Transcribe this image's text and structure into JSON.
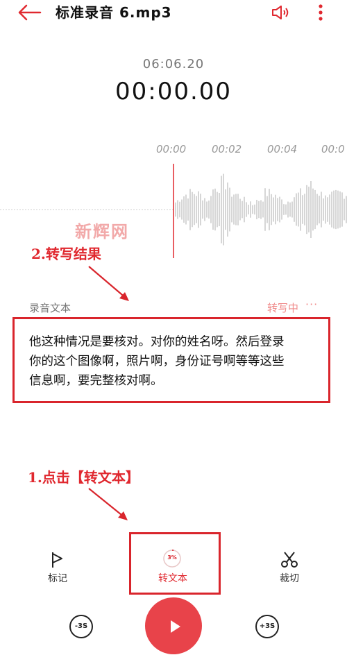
{
  "header": {
    "back_icon": "back-arrow-icon",
    "title": "标准录音 6.mp3",
    "speaker_icon": "speaker-icon",
    "more_icon": "more-vertical-icon"
  },
  "time": {
    "duration": "06:06.20",
    "current": "00:00.00"
  },
  "timeline": {
    "ticks": [
      "00:00",
      "00:02",
      "00:04",
      "00:0"
    ]
  },
  "watermark": "新辉网",
  "annotations": {
    "step2": "2.转写结果",
    "step1": "1.点击【转文本】"
  },
  "transcript": {
    "label": "录音文本",
    "status": "转写中",
    "status_dots": "···",
    "lines": [
      "他这种情况是要核对。对你的姓名呀。然后登录",
      "你的这个图像啊，照片啊，身份证号啊等等这些",
      "信息啊，要完整核对啊。"
    ]
  },
  "tools": {
    "mark_label": "标记",
    "convert_label": "转文本",
    "convert_progress_text": "3%",
    "convert_progress": 0.03,
    "cut_label": "裁切"
  },
  "playback": {
    "rewind_label": "-3S",
    "forward_label": "+3S",
    "play_icon": "play-icon"
  },
  "colors": {
    "accent": "#e8434a",
    "annotation": "#d9252c",
    "waveform": "#d6d6d6"
  }
}
